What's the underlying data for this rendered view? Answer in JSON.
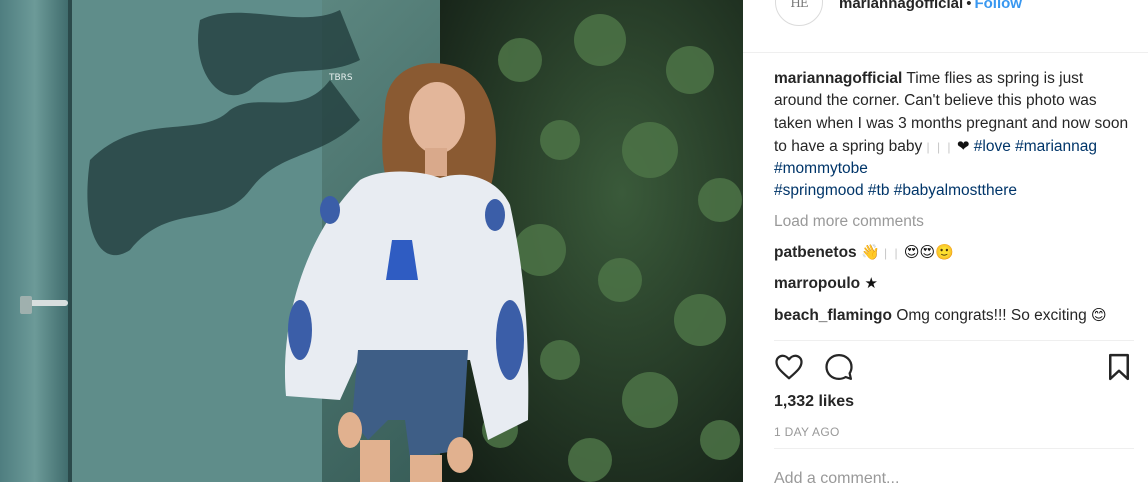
{
  "post": {
    "photo_tag": "TBRS",
    "header": {
      "avatar_text": "HE",
      "username": "mariannagofficial",
      "separator": "•",
      "follow_label": "Follow"
    },
    "caption": {
      "username": "mariannagofficial",
      "text": "Time flies as spring is just around the corner. Can't believe this photo was taken when I was 3 months pregnant and now soon to have a spring baby",
      "emoji_bars": "| | |",
      "emoji_heart": "❤",
      "hashtags": [
        "#love",
        "#mariannag",
        "#mommytobe",
        "#springmood",
        "#tb",
        "#babyalmostthere"
      ]
    },
    "load_more_label": "Load more comments",
    "comments": [
      {
        "username": "patbenetos",
        "lead_emoji": "👋",
        "bars": "| |",
        "emoji": "😍😍🙂"
      },
      {
        "username": "marropoulo",
        "emoji": "★"
      },
      {
        "username": "beach_flamingo",
        "text": "Omg congrats!!! So exciting",
        "emoji": "😊"
      }
    ],
    "likes": "1,332 likes",
    "time_ago": "1 DAY AGO",
    "add_comment_placeholder": "Add a comment..."
  },
  "colors": {
    "link_blue": "#3897f0",
    "hashtag": "#003569",
    "muted": "#999999",
    "text": "#262626"
  },
  "icons": [
    "heart-icon",
    "comment-icon",
    "bookmark-icon"
  ]
}
